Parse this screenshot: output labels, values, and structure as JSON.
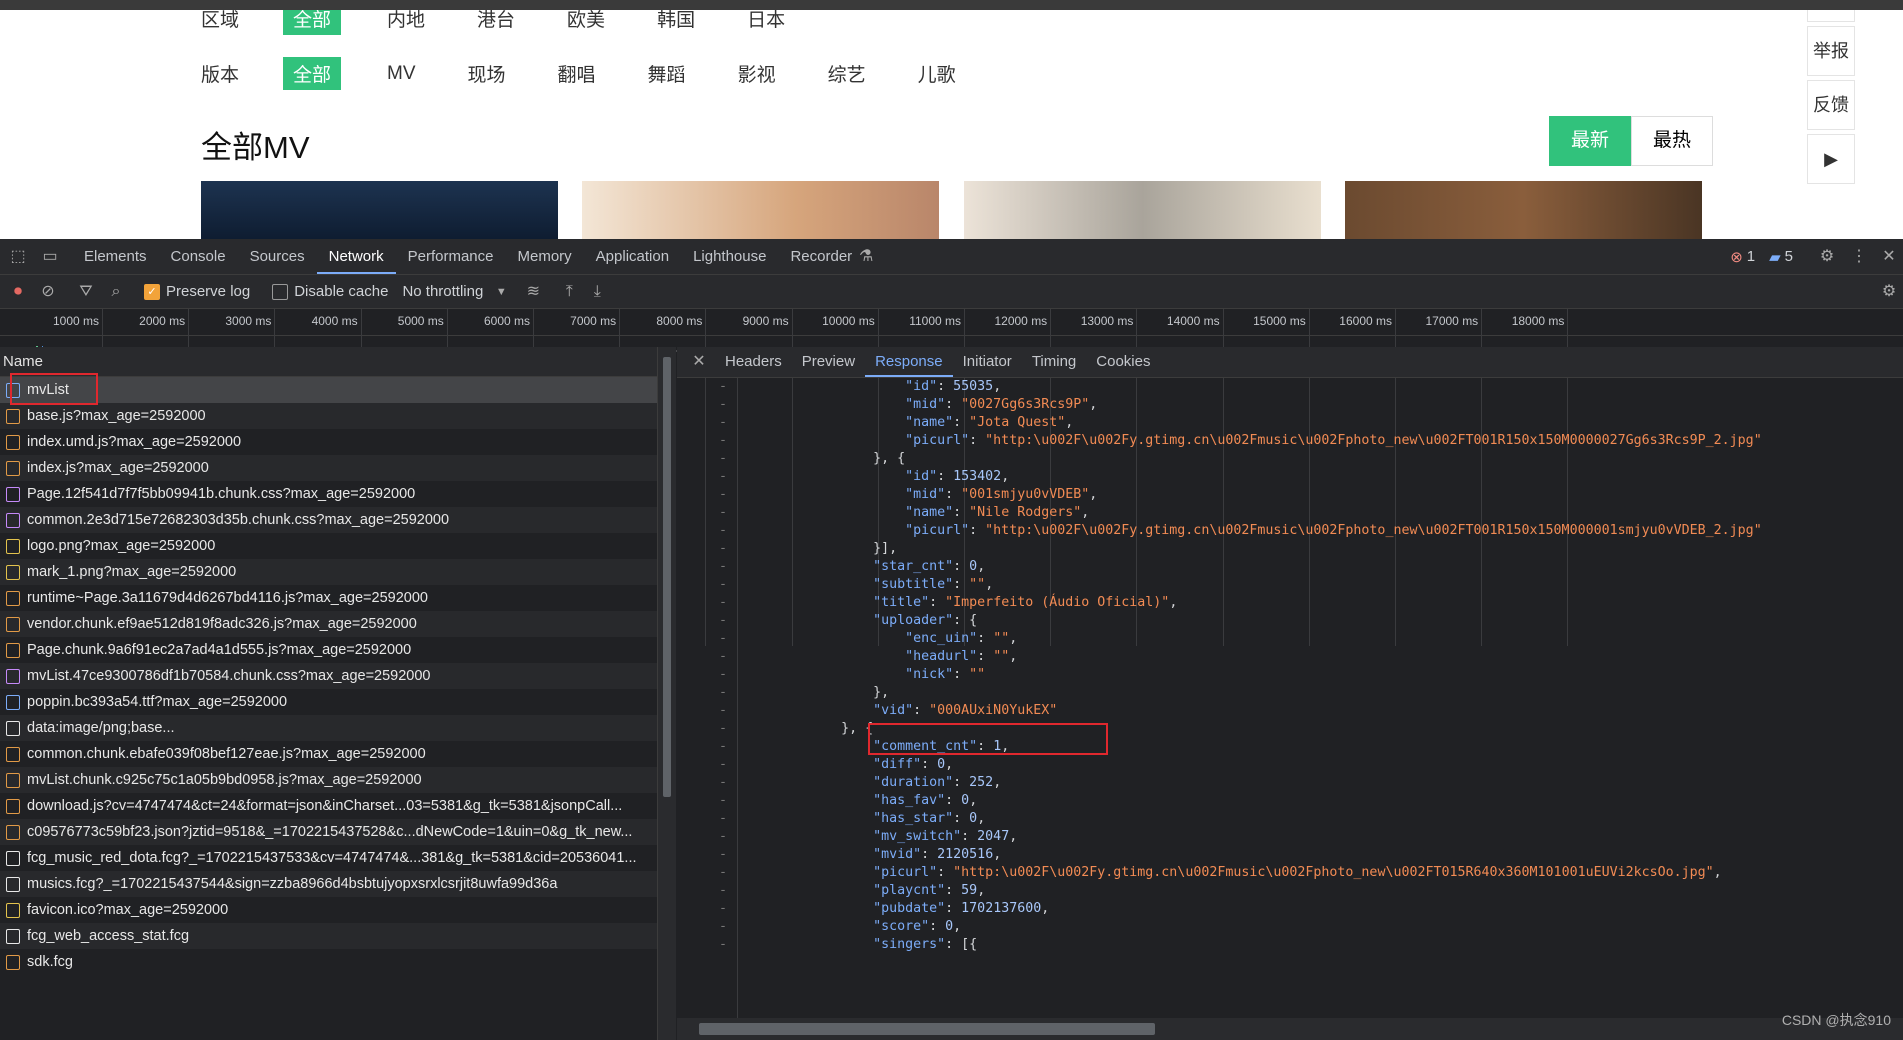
{
  "page": {
    "region_label": "区域",
    "region_options": [
      "全部",
      "内地",
      "港台",
      "欧美",
      "韩国",
      "日本"
    ],
    "version_label": "版本",
    "version_options": [
      "全部",
      "MV",
      "现场",
      "翻唱",
      "舞蹈",
      "影视",
      "综艺",
      "儿歌"
    ],
    "title": "全部MV",
    "sort_new": "最新",
    "sort_hot": "最热",
    "side_report": "举报",
    "side_feedback": "反馈",
    "side_play": "▶"
  },
  "devtools": {
    "tabs": [
      "Elements",
      "Console",
      "Sources",
      "Network",
      "Performance",
      "Memory",
      "Application",
      "Lighthouse",
      "Recorder"
    ],
    "active_tab": "Network",
    "error_count": "1",
    "message_count": "5",
    "preserve_log": "Preserve log",
    "disable_cache": "Disable cache",
    "throttling": "No throttling",
    "timeline_ticks": [
      "1000 ms",
      "2000 ms",
      "3000 ms",
      "4000 ms",
      "5000 ms",
      "6000 ms",
      "7000 ms",
      "8000 ms",
      "9000 ms",
      "10000 ms",
      "11000 ms",
      "12000 ms",
      "13000 ms",
      "14000 ms",
      "15000 ms",
      "16000 ms",
      "17000 ms",
      "18000 ms"
    ],
    "name_header": "Name",
    "requests": [
      "mvList",
      "base.js?max_age=2592000",
      "index.umd.js?max_age=2592000",
      "index.js?max_age=2592000",
      "Page.12f541d7f7f5bb09941b.chunk.css?max_age=2592000",
      "common.2e3d715e72682303d35b.chunk.css?max_age=2592000",
      "logo.png?max_age=2592000",
      "mark_1.png?max_age=2592000",
      "runtime~Page.3a11679d4d6267bd4116.js?max_age=2592000",
      "vendor.chunk.ef9ae512d819f8adc326.js?max_age=2592000",
      "Page.chunk.9a6f91ec2a7ad4a1d555.js?max_age=2592000",
      "mvList.47ce9300786df1b70584.chunk.css?max_age=2592000",
      "poppin.bc393a54.ttf?max_age=2592000",
      "data:image/png;base...",
      "common.chunk.ebafe039f08bef127eae.js?max_age=2592000",
      "mvList.chunk.c925c75c1a05b9bd0958.js?max_age=2592000",
      "download.js?cv=4747474&ct=24&format=json&inCharset...03=5381&g_tk=5381&jsonpCall...",
      "c09576773c59bf23.json?jztid=9518&_=1702215437528&c...dNewCode=1&uin=0&g_tk_new...",
      "fcg_music_red_dota.fcg?_=1702215437533&cv=4747474&...381&g_tk=5381&cid=20536041...",
      "musics.fcg?_=1702215437544&sign=zzba8966d4bsbtujyopxsrxlcsrjit8uwfa99d36a",
      "favicon.ico?max_age=2592000",
      "fcg_web_access_stat.fcg",
      "sdk.fcg"
    ],
    "detail_tabs": [
      "Headers",
      "Preview",
      "Response",
      "Initiator",
      "Timing",
      "Cookies"
    ],
    "active_detail_tab": "Response",
    "code_lines": [
      "                    \"id\": 55035,",
      "                    \"mid\": \"0027Gg6s3Rcs9P\",",
      "                    \"name\": \"Jota Quest\",",
      "                    \"picurl\": \"http:\\u002F\\u002Fy.gtimg.cn\\u002Fmusic\\u002Fphoto_new\\u002FT001R150x150M0000027Gg6s3Rcs9P_2.jpg\"",
      "                }, {",
      "                    \"id\": 153402,",
      "                    \"mid\": \"001smjyu0vVDEB\",",
      "                    \"name\": \"Nile Rodgers\",",
      "                    \"picurl\": \"http:\\u002F\\u002Fy.gtimg.cn\\u002Fmusic\\u002Fphoto_new\\u002FT001R150x150M000001smjyu0vVDEB_2.jpg\"",
      "                }],",
      "                \"star_cnt\": 0,",
      "                \"subtitle\": \"\",",
      "                \"title\": \"Imperfeito (Áudio Oficial)\",",
      "                \"uploader\": {",
      "                    \"enc_uin\": \"\",",
      "                    \"headurl\": \"\",",
      "                    \"nick\": \"\"",
      "                },",
      "                \"vid\": \"000AUxiN0YukEX\"",
      "            }, {",
      "                \"comment_cnt\": 1,",
      "                \"diff\": 0,",
      "                \"duration\": 252,",
      "                \"has_fav\": 0,",
      "                \"has_star\": 0,",
      "                \"mv_switch\": 2047,",
      "                \"mvid\": 2120516,",
      "                \"picurl\": \"http:\\u002F\\u002Fy.gtimg.cn\\u002Fmusic\\u002Fphoto_new\\u002FT015R640x360M101001uEUVi2kcsOo.jpg\",",
      "                \"playcnt\": 59,",
      "                \"pubdate\": 1702137600,",
      "                \"score\": 0,",
      "                \"singers\": [{"
    ],
    "watermark": "CSDN @执念910"
  }
}
